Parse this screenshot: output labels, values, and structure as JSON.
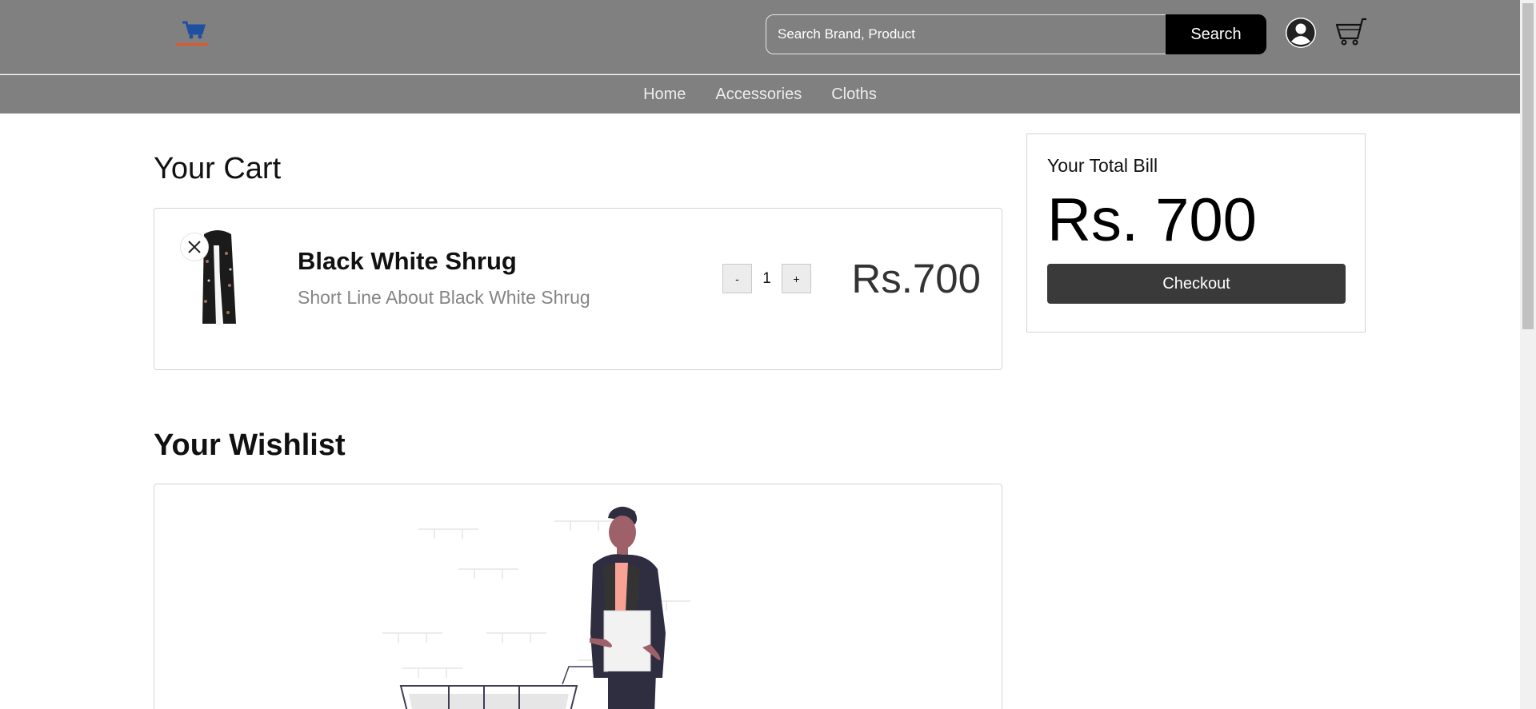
{
  "header": {
    "search": {
      "placeholder": "Search Brand, Product",
      "button_label": "Search"
    },
    "icons": {
      "logo": "cart-logo-icon",
      "user": "user-circle-icon",
      "cart": "shopping-cart-icon"
    }
  },
  "nav": {
    "items": [
      "Home",
      "Accessories",
      "Cloths"
    ]
  },
  "cart": {
    "title": "Your Cart",
    "items": [
      {
        "name": "Black White Shrug",
        "description": "Short Line About Black White Shrug",
        "quantity": "1",
        "minus_label": "-",
        "plus_label": "+",
        "price": "Rs.700"
      }
    ]
  },
  "bill": {
    "label": "Your Total Bill",
    "amount": "Rs. 700",
    "checkout_label": "Checkout"
  },
  "wishlist": {
    "title": "Your Wishlist"
  },
  "colors": {
    "header_bg": "#808080",
    "search_button": "#000000",
    "checkout_button": "#3a3a3a",
    "logo_blue": "#1f4fa0",
    "logo_orange": "#e0572a"
  }
}
